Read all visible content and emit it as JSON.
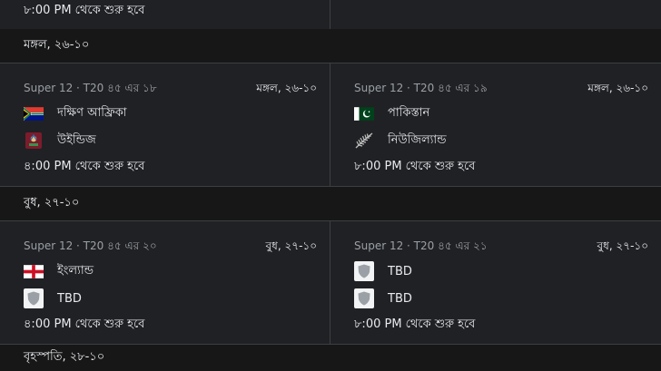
{
  "top_partial": {
    "left_time": "৮:00 PM থেকে শুরু হবে"
  },
  "days": [
    {
      "label": "মঙ্গল, ২৬-১০",
      "matches": [
        {
          "meta": "Super 12 · T20 ৪৫ এর ১৮",
          "date": "মঙ্গল, ২৬-১০",
          "team1": {
            "name": "দক্ষিণ আফ্রিকা",
            "icon": "south-africa-flag-icon"
          },
          "team2": {
            "name": "উইন্ডিজ",
            "icon": "west-indies-flag-icon"
          },
          "status": "৪:00 PM থেকে শুরু হবে"
        },
        {
          "meta": "Super 12 · T20 ৪৫ এর ১৯",
          "date": "মঙ্গল, ২৬-১০",
          "team1": {
            "name": "পাকিস্তান",
            "icon": "pakistan-flag-icon"
          },
          "team2": {
            "name": "নিউজিল্যান্ড",
            "icon": "new-zealand-fern-icon"
          },
          "status": "৮:00 PM থেকে শুরু হবে"
        }
      ]
    },
    {
      "label": "বুধ, ২৭-১০",
      "matches": [
        {
          "meta": "Super 12 · T20 ৪৫ এর ২০",
          "date": "বুধ, ২৭-১০",
          "team1": {
            "name": "ইংল্যান্ড",
            "icon": "england-flag-icon"
          },
          "team2": {
            "name": "TBD",
            "icon": "tbd-shield-icon"
          },
          "status": "৪:00 PM থেকে শুরু হবে"
        },
        {
          "meta": "Super 12 · T20 ৪৫ এর ২১",
          "date": "বুধ, ২৭-১০",
          "team1": {
            "name": "TBD",
            "icon": "tbd-shield-icon"
          },
          "team2": {
            "name": "TBD",
            "icon": "tbd-shield-icon"
          },
          "status": "৮:00 PM থেকে শুরু হবে"
        }
      ]
    },
    {
      "label": "বৃহস্পতি, ২৮-১০"
    }
  ],
  "colors": {
    "background": "#202124",
    "header_background": "#171717",
    "divider": "#3c4043",
    "text": "#e8eaed",
    "muted": "#9aa0a6"
  }
}
